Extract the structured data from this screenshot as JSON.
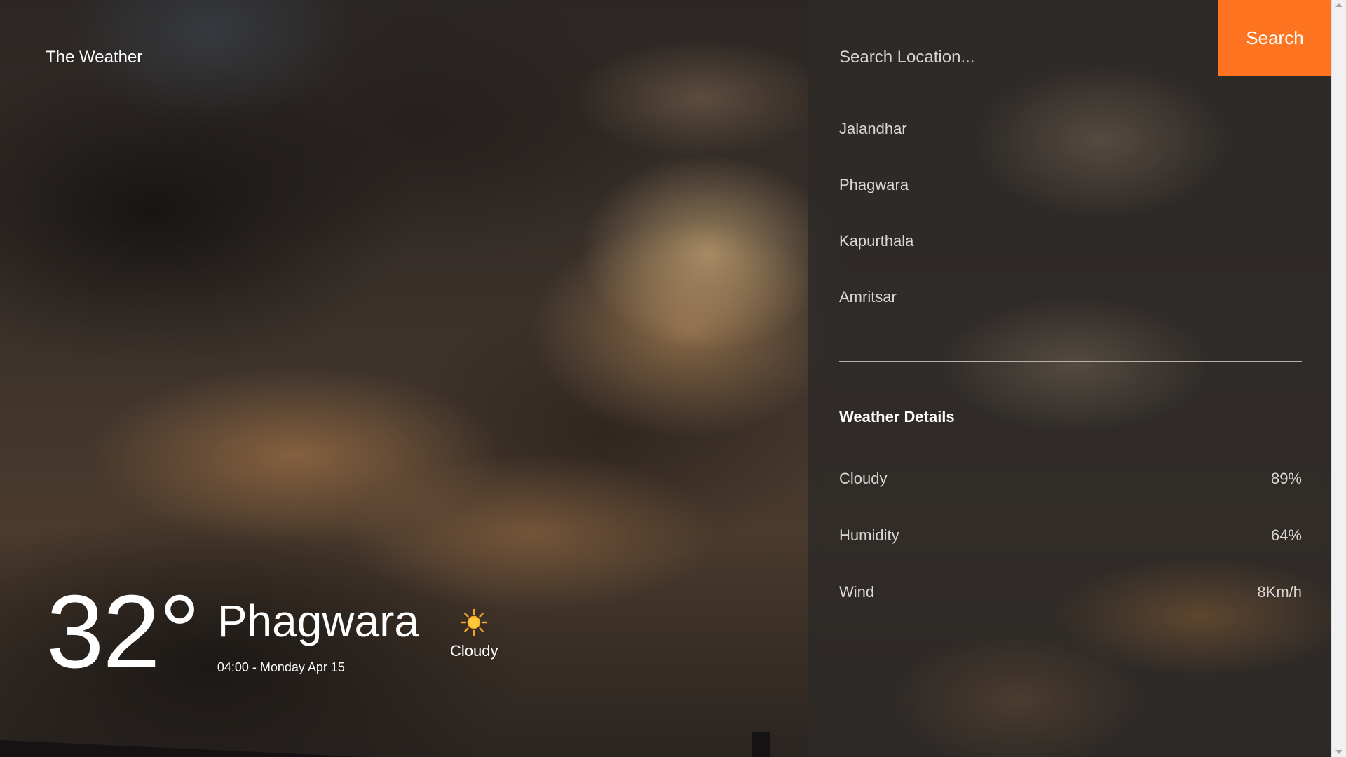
{
  "app": {
    "brand": "The Weather"
  },
  "current": {
    "temperature": "32°",
    "city": "Phagwara",
    "datetime": "04:00 - Monday Apr 15",
    "condition": "Cloudy",
    "condition_icon": "sun-icon"
  },
  "search": {
    "placeholder": "Search Location...",
    "value": "",
    "button_label": "Search"
  },
  "locations": [
    {
      "label": "Jalandhar"
    },
    {
      "label": "Phagwara"
    },
    {
      "label": "Kapurthala"
    },
    {
      "label": "Amritsar"
    }
  ],
  "details": {
    "title": "Weather Details",
    "rows": [
      {
        "label": "Cloudy",
        "value": "89%"
      },
      {
        "label": "Humidity",
        "value": "64%"
      },
      {
        "label": "Wind",
        "value": "8Km/h"
      }
    ]
  },
  "colors": {
    "accent": "#ff7420",
    "sun": "#ffc93c"
  }
}
